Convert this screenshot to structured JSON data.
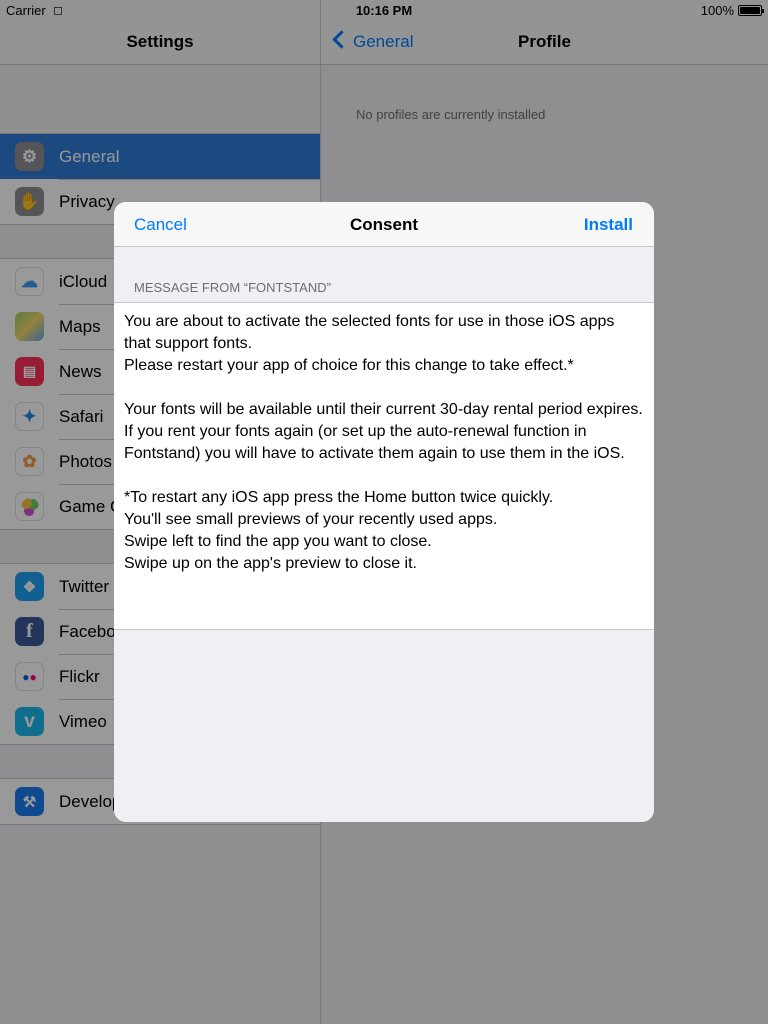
{
  "status_bar": {
    "carrier": "Carrier",
    "time": "10:16 PM",
    "battery": "100%"
  },
  "master": {
    "title": "Settings",
    "groups": [
      {
        "items": [
          {
            "label": "General",
            "icon": "gear-icon",
            "color": "#8e8e93",
            "selected": true
          },
          {
            "label": "Privacy",
            "icon": "hand-icon",
            "color": "#8e8e93"
          }
        ]
      },
      {
        "items": [
          {
            "label": "iCloud",
            "icon": "cloud-icon",
            "color": "#ffffff"
          },
          {
            "label": "Maps",
            "icon": "map-icon",
            "color": "#ffffff"
          },
          {
            "label": "News",
            "icon": "news-icon",
            "color": "#fc3158"
          },
          {
            "label": "Safari",
            "icon": "compass-icon",
            "color": "#ffffff"
          },
          {
            "label": "Photos",
            "icon": "flower-icon",
            "color": "#ffffff"
          },
          {
            "label": "Game C",
            "icon": "game-center-icon",
            "color": "#ffffff"
          }
        ]
      },
      {
        "items": [
          {
            "label": "Twitter",
            "icon": "twitter-icon",
            "color": "#1da1f2"
          },
          {
            "label": "Facebo",
            "icon": "facebook-icon",
            "color": "#3b5998"
          },
          {
            "label": "Flickr",
            "icon": "flickr-icon",
            "color": "#ffffff"
          },
          {
            "label": "Vimeo",
            "icon": "vimeo-icon",
            "color": "#1ab7ea"
          }
        ]
      },
      {
        "items": [
          {
            "label": "Develop",
            "icon": "hammer-icon",
            "color": "#1a7cf0"
          }
        ]
      }
    ]
  },
  "detail": {
    "back_label": "General",
    "title": "Profile",
    "empty_message": "No profiles are currently installed"
  },
  "modal": {
    "cancel_label": "Cancel",
    "title": "Consent",
    "install_label": "Install",
    "section_header": "MESSAGE FROM “FONTSTAND”",
    "paragraphs": [
      "You are about to activate the selected fonts for use in those iOS apps that support fonts.\nPlease restart your app of choice for this change to take effect.*",
      "Your fonts will be available until their current 30-day rental period expires. If you rent your fonts again (or set up the auto-renewal function in Fontstand) you will have to activate them again to use them in the iOS.",
      "*To restart any iOS app press the Home button twice quickly.\nYou'll see small previews of your recently used apps.\nSwipe left to find the app you want to close.\nSwipe up on the app's preview to close it."
    ]
  }
}
